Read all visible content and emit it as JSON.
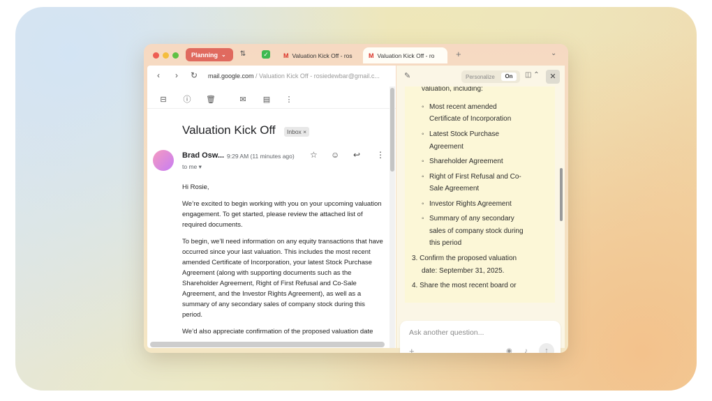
{
  "browser": {
    "space_label": "Planning",
    "tabs": [
      {
        "label": "Valuation Kick Off - ros"
      },
      {
        "label": "Valuation Kick Off - ro"
      }
    ],
    "address": {
      "domain": "mail.google.com",
      "path": " / Valuation Kick Off - rosiedewbar@gmail.c..."
    }
  },
  "email": {
    "subject": "Valuation Kick Off",
    "label_badge": "Inbox ×",
    "sender": "Brad Osw...",
    "time": "9:29 AM (11 minutes ago)",
    "to": "to me ▾",
    "paragraphs": [
      "Hi Rosie,",
      "We’re excited to begin working with you on your upcoming valuation engagement. To get started, please review the attached list of required documents.",
      "To begin, we’ll need information on any equity transactions that have occurred since your last valuation. This includes the most recent amended Certificate of Incorporation, your latest Stock Purchase Agreement (along with supporting documents such as the Shareholder Agreement, Right of First Refusal and Co-Sale Agreement, and the Investor Rights Agreement), as well as a summary of any secondary sales of company stock during this period.",
      "We’d also appreciate confirmation of the proposed valuation date"
    ]
  },
  "assistant": {
    "personalize_label": "Personalize",
    "personalize_state": "On",
    "lines": [
      {
        "text": "valuation, including:"
      },
      {
        "text": "Most recent amended"
      },
      {
        "text": "Certificate of Incorporation"
      },
      {
        "text": "Latest Stock Purchase"
      },
      {
        "text": "Agreement"
      },
      {
        "text": "Shareholder Agreement"
      },
      {
        "text": "Right of First Refusal and Co-"
      },
      {
        "text": "Sale Agreement"
      },
      {
        "text": "Investor Rights Agreement"
      },
      {
        "text": "Summary of any secondary"
      },
      {
        "text": "sales of company stock during"
      },
      {
        "text": "this period"
      },
      {
        "text": "3.  Confirm the proposed valuation"
      },
      {
        "text": "date: September 31, 2025."
      },
      {
        "text": "4.  Share the most recent board or"
      }
    ],
    "ask_placeholder": "Ask another question..."
  }
}
